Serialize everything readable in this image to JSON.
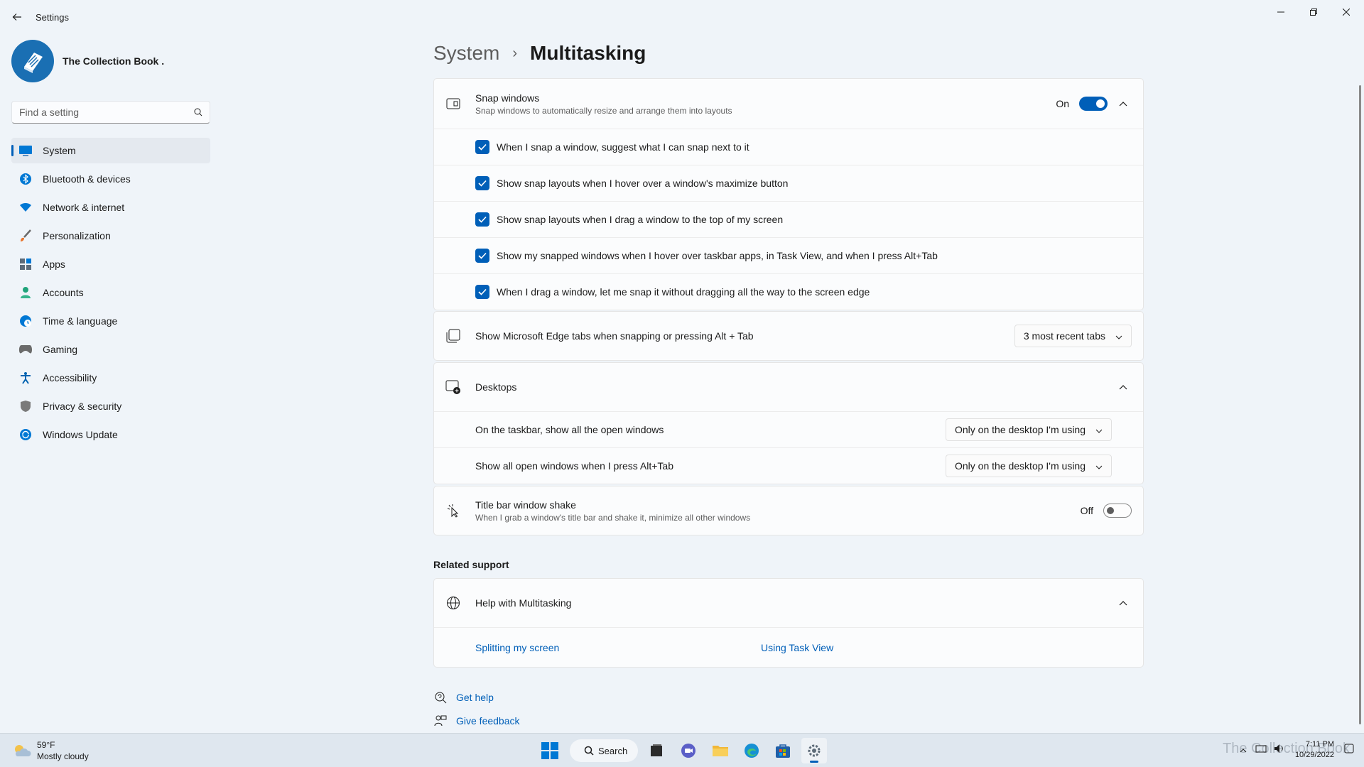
{
  "window": {
    "title": "Settings"
  },
  "profile": {
    "name": "The Collection Book ."
  },
  "search": {
    "placeholder": "Find a setting"
  },
  "sidebar": {
    "items": [
      {
        "label": "System",
        "icon": "monitor-icon",
        "color": "#0078d4"
      },
      {
        "label": "Bluetooth & devices",
        "icon": "bluetooth-icon",
        "color": "#0078d4"
      },
      {
        "label": "Network & internet",
        "icon": "wifi-icon",
        "color": "#0078d4"
      },
      {
        "label": "Personalization",
        "icon": "brush-icon",
        "color": "#e8742b"
      },
      {
        "label": "Apps",
        "icon": "apps-icon",
        "color": "#5c6b7a"
      },
      {
        "label": "Accounts",
        "icon": "person-icon",
        "color": "#1fa37a"
      },
      {
        "label": "Time & language",
        "icon": "globe-clock-icon",
        "color": "#0078d4"
      },
      {
        "label": "Gaming",
        "icon": "gamepad-icon",
        "color": "#6b6b6b"
      },
      {
        "label": "Accessibility",
        "icon": "accessibility-icon",
        "color": "#0063b1"
      },
      {
        "label": "Privacy & security",
        "icon": "shield-icon",
        "color": "#6b6b6b"
      },
      {
        "label": "Windows Update",
        "icon": "update-icon",
        "color": "#0078d4"
      }
    ],
    "active_index": 0
  },
  "breadcrumb": {
    "parent": "System",
    "separator": "›",
    "current": "Multitasking"
  },
  "snap": {
    "title": "Snap windows",
    "description": "Snap windows to automatically resize and arrange them into layouts",
    "state": "On",
    "options": [
      "When I snap a window, suggest what I can snap next to it",
      "Show snap layouts when I hover over a window's maximize button",
      "Show snap layouts when I drag a window to the top of my screen",
      "Show my snapped windows when I hover over taskbar apps, in Task View, and when I press Alt+Tab",
      "When I drag a window, let me snap it without dragging all the way to the screen edge"
    ]
  },
  "edge_tabs": {
    "title": "Show Microsoft Edge tabs when snapping or pressing Alt + Tab",
    "value": "3 most recent tabs"
  },
  "desktops": {
    "title": "Desktops",
    "rows": [
      {
        "label": "On the taskbar, show all the open windows",
        "value": "Only on the desktop I'm using"
      },
      {
        "label": "Show all open windows when I press Alt+Tab",
        "value": "Only on the desktop I'm using"
      }
    ]
  },
  "shake": {
    "title": "Title bar window shake",
    "description": "When I grab a window's title bar and shake it, minimize all other windows",
    "state": "Off"
  },
  "related": {
    "heading": "Related support",
    "help_title": "Help with Multitasking",
    "links": [
      "Splitting my screen",
      "Using Task View"
    ]
  },
  "footer_links": {
    "get_help": "Get help",
    "feedback": "Give feedback"
  },
  "taskbar": {
    "weather_temp": "59°F",
    "weather_desc": "Mostly cloudy",
    "search_label": "Search",
    "time": "7:11 PM",
    "date": "10/29/2022",
    "watermark": "The Collection Book"
  },
  "colors": {
    "accent": "#005fb8",
    "background": "#eff4f9"
  }
}
